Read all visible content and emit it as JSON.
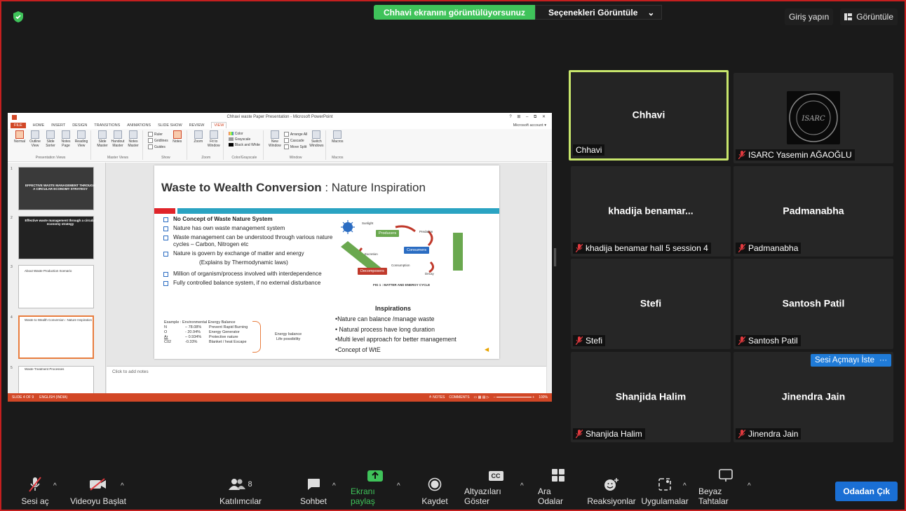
{
  "top": {
    "share_banner": "Chhavi ekranını görüntülüyorsunuz",
    "view_options": "Seçenekleri Görüntüle",
    "signin": "Giriş yapın",
    "view": "Görüntüle"
  },
  "ppt": {
    "window_title": "Chhavi waste Paper Presentation - Microsoft PowerPoint",
    "window_controls": "? ⊞ – ⧉ ✕",
    "tabs": [
      "FILE",
      "HOME",
      "INSERT",
      "DESIGN",
      "TRANSITIONS",
      "ANIMATIONS",
      "SLIDE SHOW",
      "REVIEW",
      "VIEW"
    ],
    "account": "Microsoft account ▾",
    "ribbon": {
      "presentation_views": [
        "Normal",
        "Outline View",
        "Slide Sorter",
        "Notes Page",
        "Reading View"
      ],
      "presentation_views_label": "Presentation Views",
      "master_views": [
        "Slide Master",
        "Handout Master",
        "Notes Master"
      ],
      "master_views_label": "Master Views",
      "show_items": [
        "Ruler",
        "Gridlines",
        "Guides"
      ],
      "show_label": "Show",
      "notes": "Notes",
      "zoom_items": [
        "Zoom",
        "Fit to Window"
      ],
      "zoom_label": "Zoom",
      "color_items": [
        "Color",
        "Grayscale",
        "Black and White"
      ],
      "color_label": "Color/Grayscale",
      "window_items": [
        "New Window",
        "Arrange All",
        "Cascade",
        "Move Split",
        "Switch Windows"
      ],
      "window_label": "Window",
      "macros": "Macros",
      "macros_label": "Macros"
    },
    "thumbs": [
      {
        "n": "1",
        "text": "EFFECTIVE WASTE MANAGEMENT THROUGH A CIRCULAR ECONOMY STRATEGY"
      },
      {
        "n": "2",
        "text": "Effective waste management through a circular economy strategy"
      },
      {
        "n": "3",
        "text": "About Waste Production Scenario"
      },
      {
        "n": "4",
        "text": "Waste to Wealth Conversion : Nature Inspiration"
      },
      {
        "n": "5",
        "text": "Waste Treatment Processes"
      }
    ],
    "notes_placeholder": "Click to add notes",
    "status_left": "SLIDE 4 OF 9",
    "status_lang": "ENGLISH (INDIA)",
    "status_notes": "≙ NOTES",
    "status_comments": "COMMENTS",
    "status_zoom": "100%",
    "slide": {
      "title_bold": "Waste to Wealth Conversion",
      "title_rest": " : Nature Inspiration",
      "bullets": [
        "No Concept of Waste Nature System",
        "Nature has own waste management system",
        "Waste management can be understood through various nature cycles – Carbon, Nitrogen etc",
        "Nature is  govern by exchange of matter and energy"
      ],
      "explains": "(Explains by Thermodynamic laws)",
      "bullets2": [
        "Million of organism/process involved with interdependence",
        "Fully controlled  balance system,  if no external disturbance"
      ],
      "example_head": "Example : Environmental Energy Balance",
      "example_rows": [
        [
          "N",
          "– 78.08%",
          "Prevent Rapid Burning"
        ],
        [
          "O",
          "- 20.94%",
          "Energy Generator"
        ],
        [
          "Ar",
          "– 0.934%",
          "Protective nature"
        ],
        [
          "C02",
          "-0.33%",
          "Blanket / heat Escape"
        ]
      ],
      "energy_balance": "Energy  balance",
      "life_possibility": "Life  possibility",
      "cycle": {
        "producers": "Producers",
        "consumers": "Consumers",
        "decomposers": "Decomposers",
        "sunlight": "Sunlight",
        "predation": "Predation",
        "decay": "Decay",
        "consumption": "Consumption",
        "excretion": "Excretion"
      },
      "fig_caption": "FIG 1 : MATTER AND ENERGY  CYCLE",
      "inspirations_title": "Inspirations",
      "inspirations": [
        "•Nature can balance /manage waste",
        "• Natural process  have long duration",
        "•Multi level approach for better management",
        "•Concept  of  WtE"
      ]
    }
  },
  "participants": [
    {
      "name": "Chhavi",
      "label": "Chhavi",
      "muted": false,
      "speaking": true
    },
    {
      "name": "",
      "label": "ISARC Yasemin AĞAOĞLU",
      "muted": true,
      "logo": "ISARC"
    },
    {
      "name": "khadija  benamar...",
      "label": "khadija benamar hall 5 session 4",
      "muted": true
    },
    {
      "name": "Padmanabha",
      "label": "Padmanabha",
      "muted": true
    },
    {
      "name": "Stefi",
      "label": "Stefi",
      "muted": true
    },
    {
      "name": "Santosh Patil",
      "label": "Santosh Patil",
      "muted": true
    },
    {
      "name": "Shanjida Halim",
      "label": "Shanjida Halim",
      "muted": true
    },
    {
      "name": "Jinendra Jain",
      "label": "Jinendra Jain",
      "muted": true
    }
  ],
  "ask_unmute": "Sesi Açmayı İste",
  "more": "···",
  "toolbar": {
    "unmute": "Sesi aç",
    "start_video": "Videoyu Başlat",
    "participants": "Katılımcılar",
    "participants_count": "8",
    "chat": "Sohbet",
    "share_screen": "Ekranı paylaş",
    "record": "Kaydet",
    "captions": "Altyazıları Göster",
    "cc": "CC",
    "breakout": "Ara Odalar",
    "reactions": "Reaksiyonlar",
    "apps": "Uygulamalar",
    "whiteboards": "Beyaz Tahtalar",
    "leave": "Odadan Çık"
  },
  "colors": {
    "accent_green": "#3fc35a",
    "speaking_border": "#c8e66c",
    "zoom_blue": "#1f7bd8",
    "frame_red": "#c51f1f",
    "ppt_orange": "#d24726"
  }
}
